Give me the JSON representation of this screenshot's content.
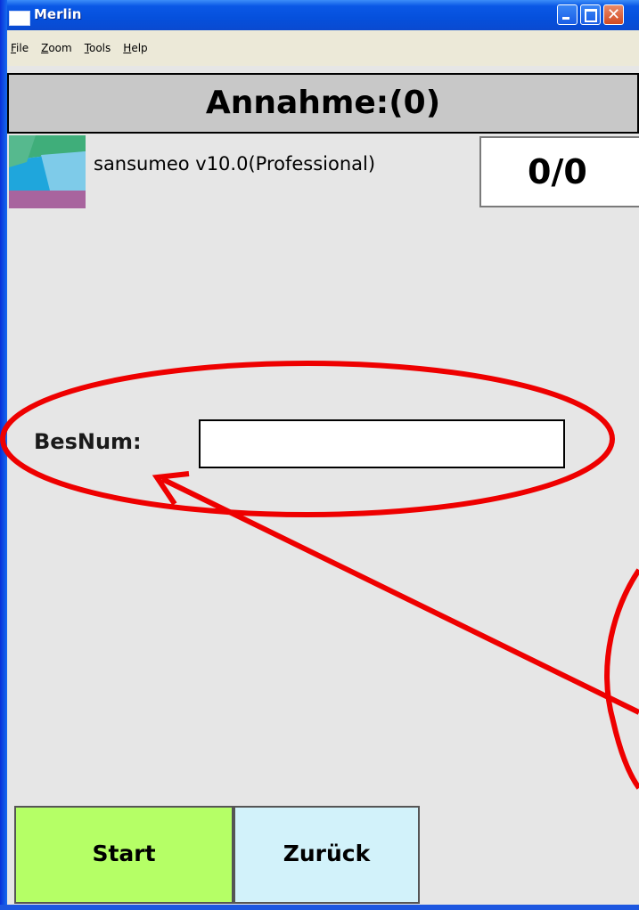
{
  "window": {
    "title": "Merlin"
  },
  "menu": [
    "File",
    "Zoom",
    "Tools",
    "Help"
  ],
  "header": {
    "title": "Annahme:(0)"
  },
  "brand": {
    "label": "sansumeo v10.0(Professional)"
  },
  "counter": {
    "value": "0/0"
  },
  "form": {
    "label": "BesNum:",
    "value": "",
    "placeholder": ""
  },
  "buttons": {
    "start": "Start",
    "back": "Zurück"
  },
  "colors": {
    "annotation": "#ee0000",
    "start_bg": "#b5ff66",
    "back_bg": "#d2f2fa",
    "header_bg": "#c8c8c8"
  }
}
